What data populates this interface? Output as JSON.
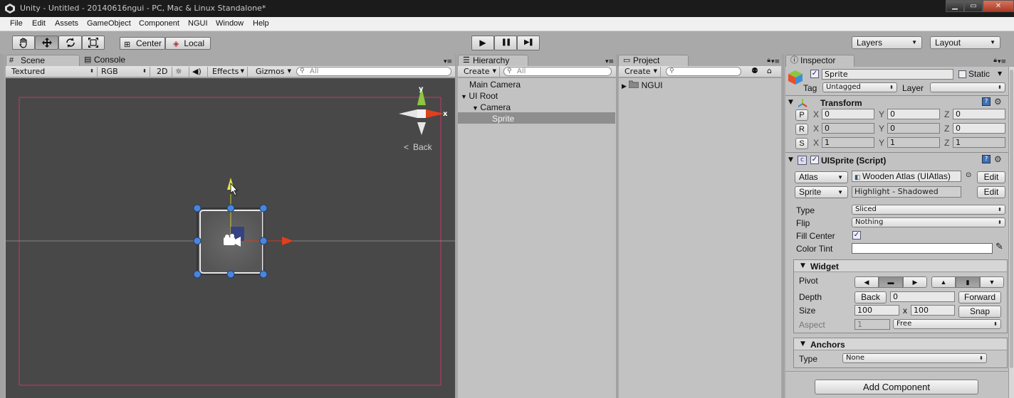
{
  "window": {
    "title": "Unity - Untitled - 20140616ngui - PC, Mac & Linux Standalone*",
    "min": "▁",
    "max": "▭",
    "close": "✕"
  },
  "menu": [
    "File",
    "Edit",
    "Assets",
    "GameObject",
    "Component",
    "NGUI",
    "Window",
    "Help"
  ],
  "toolbar": {
    "tools": [
      "hand-icon",
      "move-icon",
      "rotate-icon",
      "scale-icon"
    ],
    "pivot": "Center",
    "space": "Local",
    "play": "▶",
    "pause": "❚❚",
    "step": "▶❚",
    "layers": "Layers",
    "layout": "Layout"
  },
  "scene": {
    "tab_scene": "Scene",
    "tab_console": "Console",
    "draw_mode": "Textured",
    "render_mode": "RGB",
    "mode_2d": "2D",
    "effects": "Effects",
    "gizmos": "Gizmos",
    "search_placeholder": "All",
    "gizmo_y": "y",
    "gizmo_x": "x",
    "gizmo_view": "Back"
  },
  "hierarchy": {
    "tab": "Hierarchy",
    "create": "Create",
    "search_placeholder": "All",
    "items": [
      "Main Camera",
      "UI Root",
      "Camera",
      "Sprite"
    ]
  },
  "project": {
    "tab": "Project",
    "create": "Create",
    "items": [
      "NGUI"
    ]
  },
  "inspector": {
    "tab": "Inspector",
    "name": "Sprite",
    "static": "Static",
    "tag_label": "Tag",
    "tag": "Untagged",
    "layer_label": "Layer",
    "layer": "",
    "transform": {
      "title": "Transform",
      "p": "P",
      "r": "R",
      "s": "S",
      "x": "X",
      "y": "Y",
      "z": "Z",
      "position": [
        "0",
        "0",
        "0"
      ],
      "rotation": [
        "0",
        "0",
        "0"
      ],
      "scale": [
        "1",
        "1",
        "1"
      ]
    },
    "uisprite": {
      "title": "UISprite (Script)",
      "atlas_label": "Atlas",
      "atlas_value": "Wooden Atlas (UIAtlas)",
      "sprite_label": "Sprite",
      "sprite_value": "Highlight - Shadowed",
      "edit": "Edit",
      "type_label": "Type",
      "type": "Sliced",
      "flip_label": "Flip",
      "flip": "Nothing",
      "fill_center_label": "Fill Center",
      "color_tint_label": "Color Tint",
      "color_tint": "#ffffff"
    },
    "widget": {
      "title": "Widget",
      "pivot_label": "Pivot",
      "depth_label": "Depth",
      "back": "Back",
      "depth": "0",
      "forward": "Forward",
      "size_label": "Size",
      "width": "100",
      "x": "x",
      "height": "100",
      "snap": "Snap",
      "aspect_label": "Aspect",
      "aspect": "1",
      "aspect_mode": "Free"
    },
    "anchors": {
      "title": "Anchors",
      "type_label": "Type",
      "type": "None"
    },
    "add_component": "Add Component"
  },
  "colors": {
    "gizmo_x": "#e0401c",
    "gizmo_y": "#8dc63f",
    "selection": "#4a86d8",
    "frame": "#c8336a"
  }
}
